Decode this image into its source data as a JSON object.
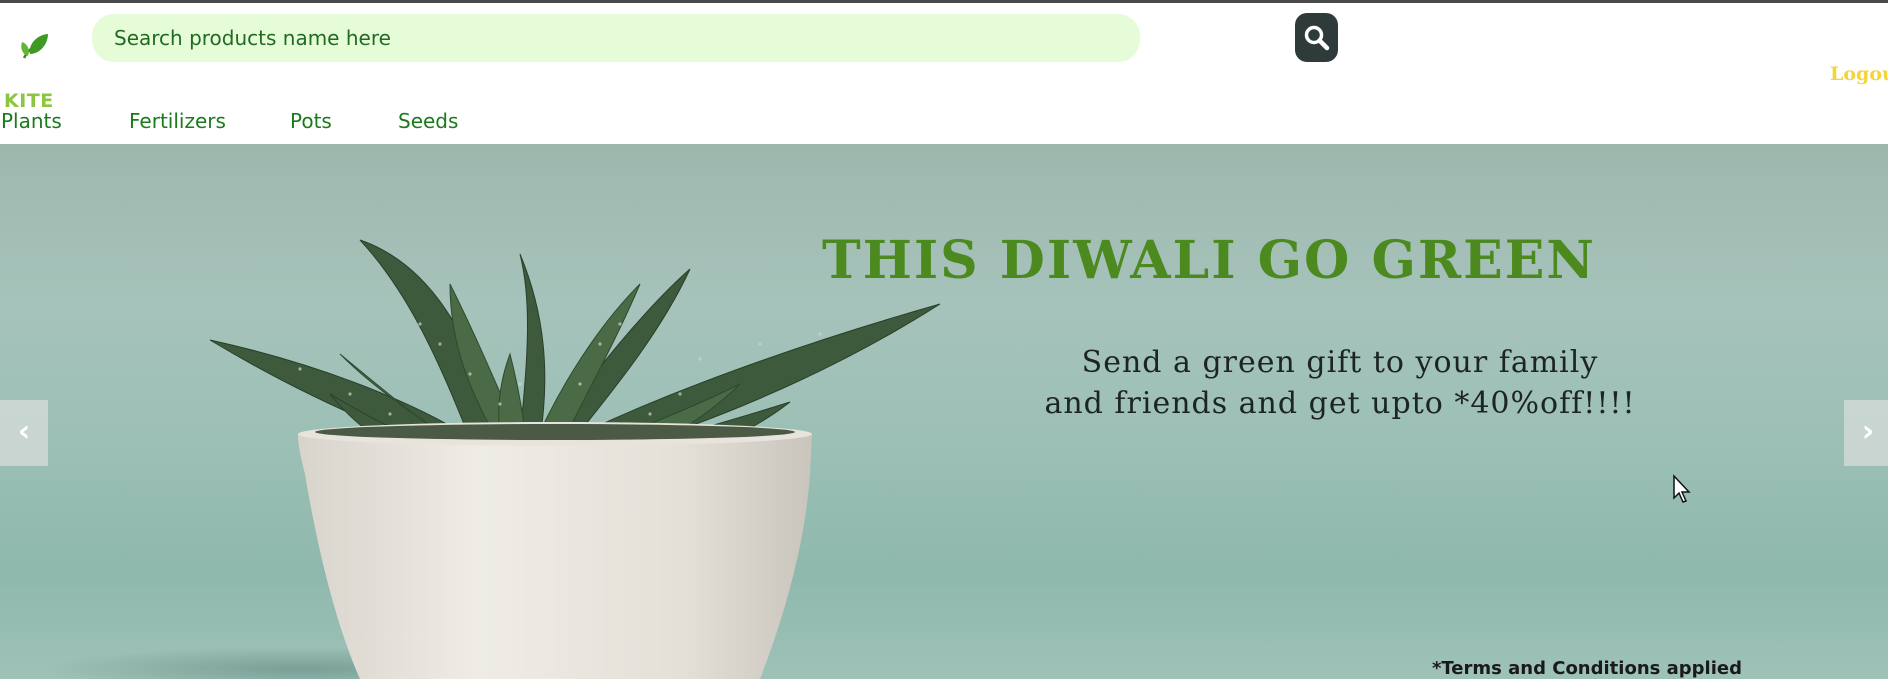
{
  "header": {
    "logo_text": "KITE",
    "search": {
      "placeholder": "Search products name here",
      "value": ""
    },
    "search_button_icon": "search-icon",
    "logout_label": "Logout"
  },
  "nav": {
    "items": [
      {
        "label": "Plants"
      },
      {
        "label": "Fertilizers"
      },
      {
        "label": "Pots"
      },
      {
        "label": "Seeds"
      }
    ]
  },
  "banner": {
    "headline": "THIS DIWALI GO GREEN",
    "subtext_line1": "Send a green gift to your family",
    "subtext_line2": "and friends and get upto *40%off!!!!",
    "terms": "*Terms and Conditions applied",
    "prev_label": "‹",
    "next_label": "›"
  },
  "colors": {
    "brand_green": "#1b7a1b",
    "logo_green": "#8cc63f",
    "headline_green": "#4c8a20",
    "search_bg": "#e6fbd8",
    "logout_yellow": "#f3d43a"
  }
}
